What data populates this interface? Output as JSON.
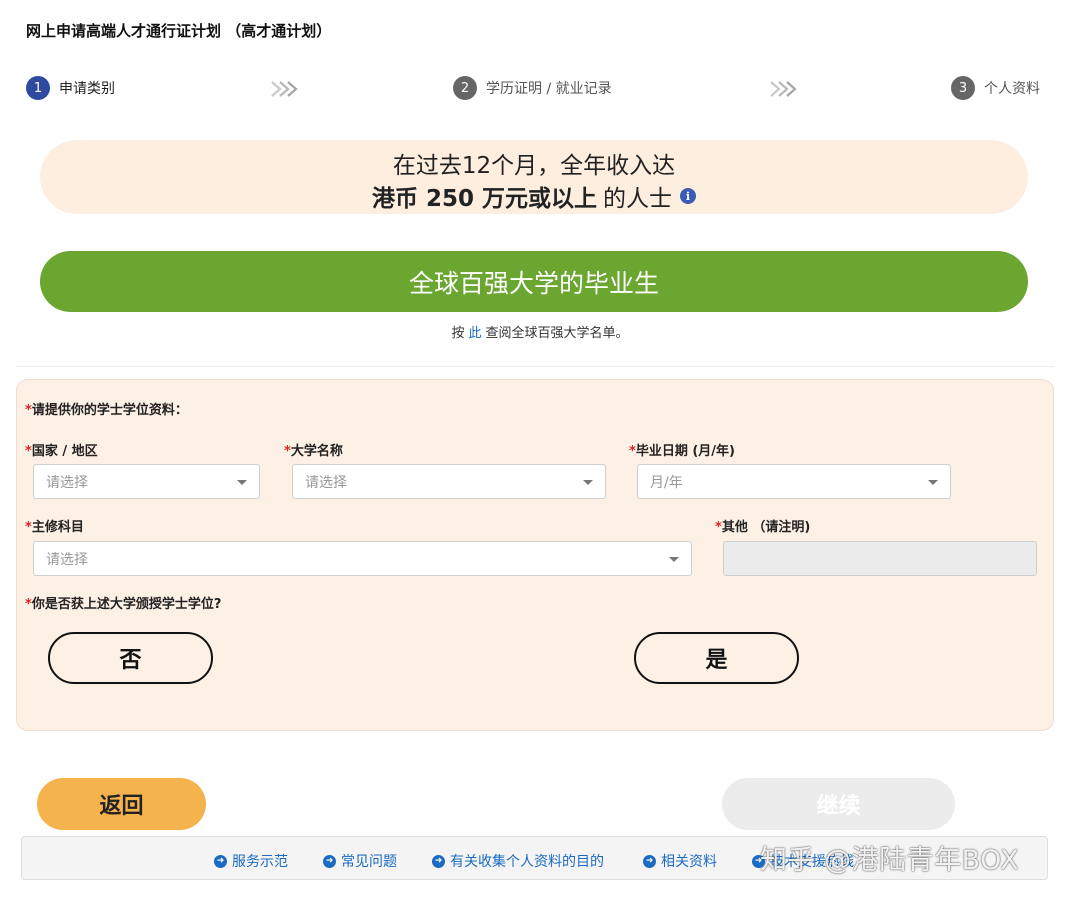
{
  "page": {
    "title": "网上申请高端人才通行证计划 （高才通计划）"
  },
  "steps": [
    {
      "num": "1",
      "label": "申请类别",
      "active": true
    },
    {
      "num": "2",
      "label": "学历证明 / 就业记录"
    },
    {
      "num": "3",
      "label": "个人资料"
    }
  ],
  "income_banner": {
    "line1": "在过去12个月，全年收入达",
    "line2_bold": "港币 250 万元或以上",
    "line2_rest": "的人士",
    "info_icon": "i"
  },
  "uni_banner": {
    "label": "全球百强大学的毕业生",
    "note_prefix": "按",
    "note_link": "此",
    "note_suffix": "查阅全球百强大学名单。"
  },
  "form": {
    "section_label": "请提供你的学士学位资料：",
    "required_mark": "*",
    "country": {
      "label": "国家 / 地区",
      "placeholder": "请选择"
    },
    "university": {
      "label": "大学名称",
      "placeholder": "请选择"
    },
    "grad_date": {
      "label": "毕业日期 (月/年)",
      "placeholder": "月/年"
    },
    "major": {
      "label": "主修科目",
      "placeholder": "请选择"
    },
    "other": {
      "label": "其他 （请注明)"
    },
    "degree_question": "你是否获上述大学颁授学士学位?",
    "no_label": "否",
    "yes_label": "是"
  },
  "actions": {
    "back_label": "返回",
    "next_label": "继续"
  },
  "footer": {
    "links": [
      "服务示范",
      "常见问题",
      "有关收集个人资料的目的",
      "相关资料",
      "技术支援热线"
    ],
    "link_icon": "➜"
  },
  "watermark": "知乎 @港陆青年BOX",
  "colors": {
    "step_active": "#2d4aa0",
    "income_bg": "#fdeee0",
    "uni_green": "#6aa630",
    "form_bg": "#fdf1e6",
    "back_orange": "#f5b34e",
    "link_blue": "#1a6bc4",
    "required_red": "#dd2222"
  }
}
